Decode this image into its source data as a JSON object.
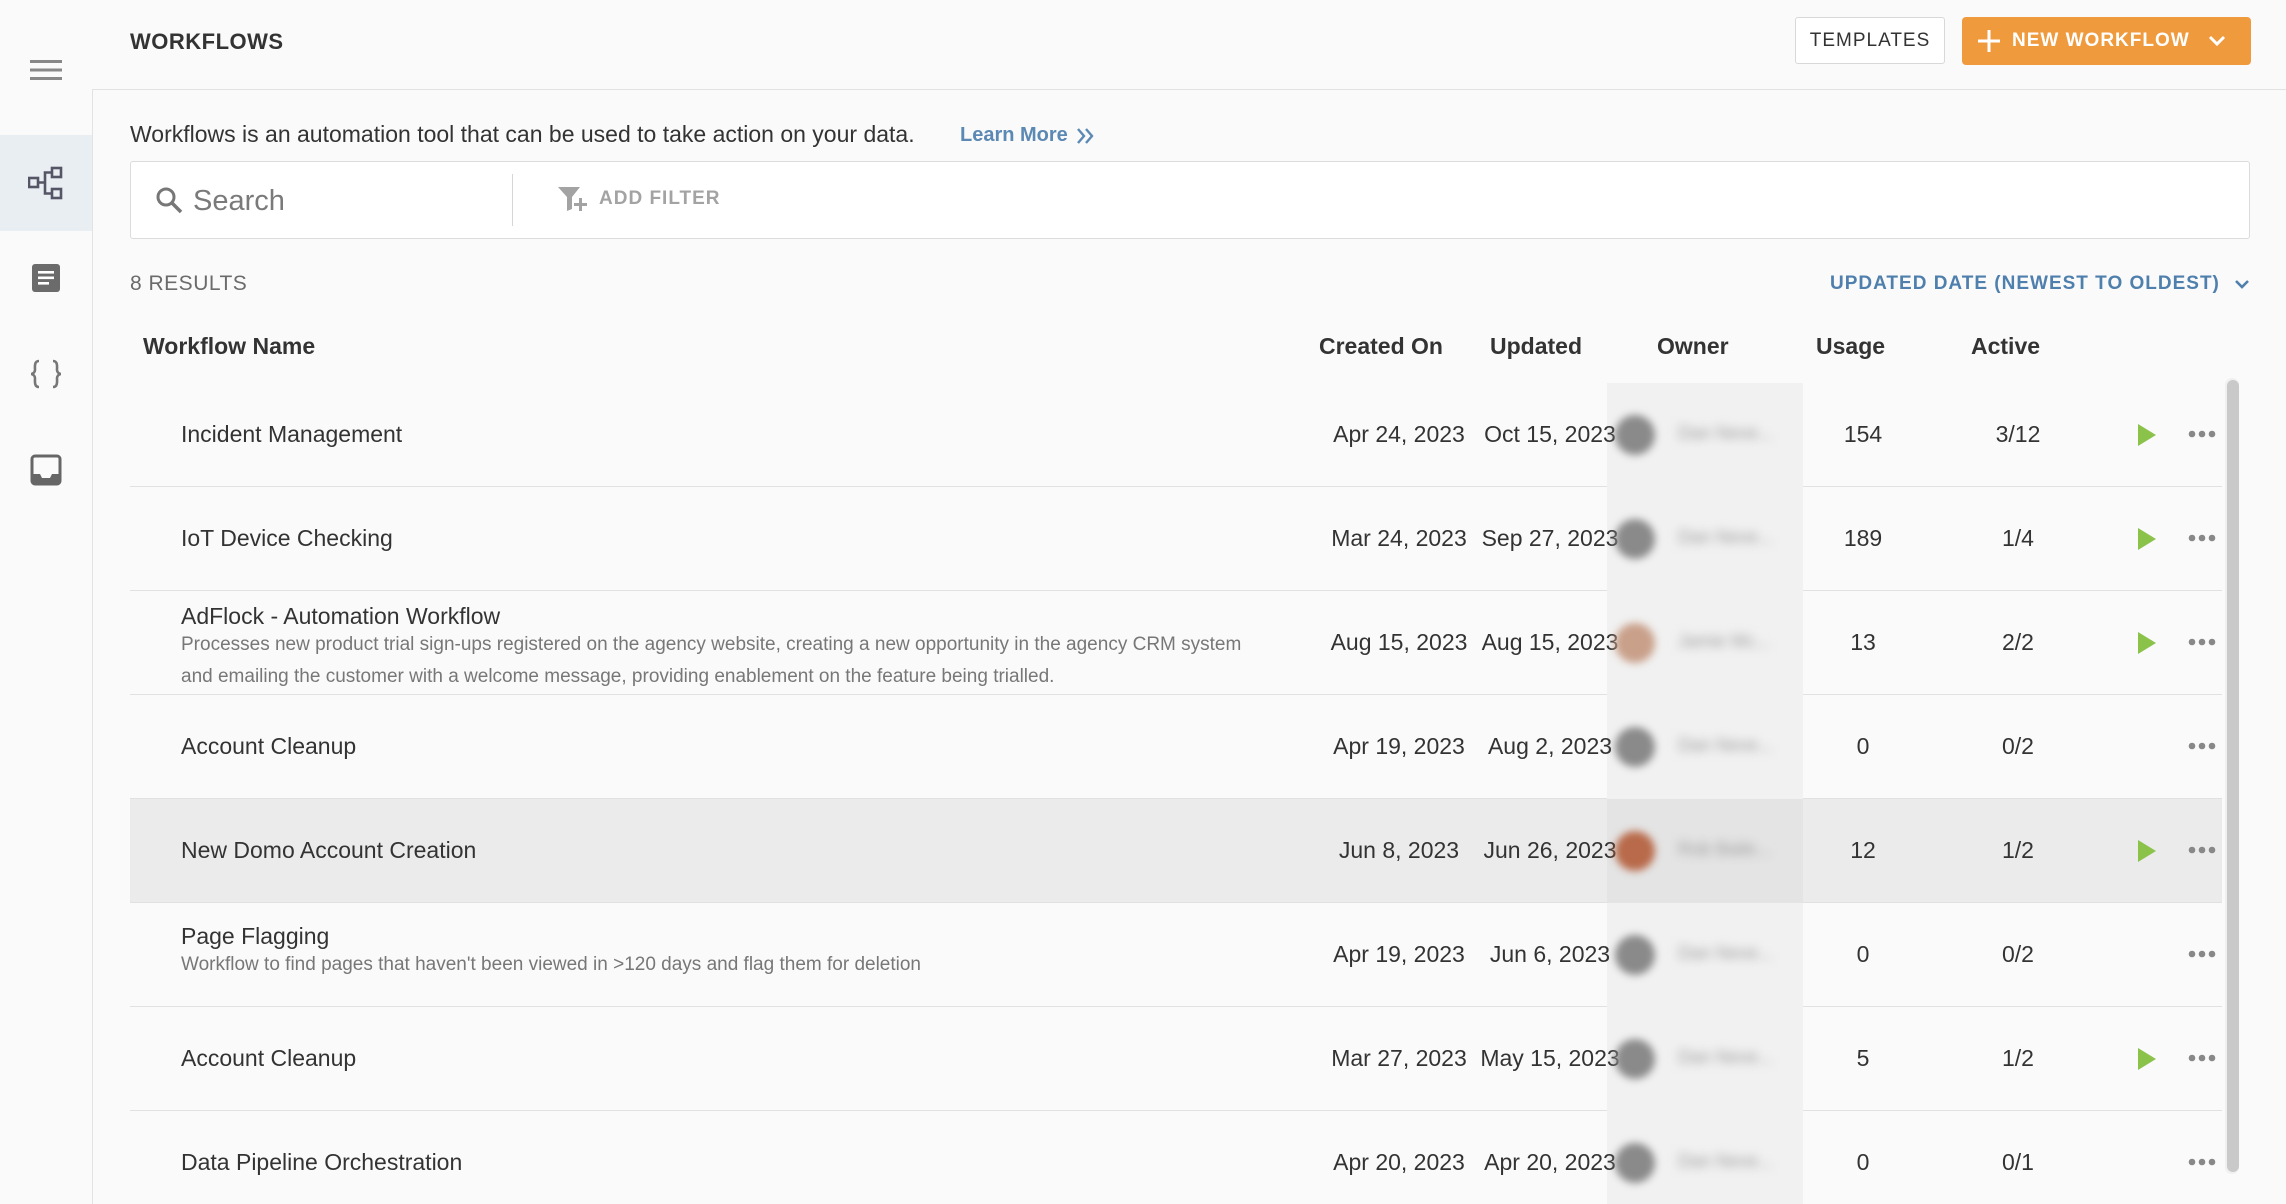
{
  "sidebar": {
    "items": [
      {
        "icon": "menu-icon"
      },
      {
        "icon": "workflow-icon",
        "active": true
      },
      {
        "icon": "document-icon"
      },
      {
        "icon": "code-braces-icon"
      },
      {
        "icon": "inbox-icon"
      }
    ]
  },
  "header": {
    "title": "WORKFLOWS",
    "templates_label": "TEMPLATES",
    "new_workflow_label": "NEW WORKFLOW"
  },
  "intro": {
    "text": "Workflows is an automation tool that can be used to take action on your data.",
    "learn_more": "Learn More"
  },
  "search": {
    "placeholder": "Search",
    "add_filter_label": "ADD FILTER"
  },
  "results": {
    "count_label": "8 RESULTS",
    "sort_label": "UPDATED DATE (NEWEST TO OLDEST)"
  },
  "table": {
    "columns": {
      "name": "Workflow Name",
      "created": "Created On",
      "updated": "Updated",
      "owner": "Owner",
      "usage": "Usage",
      "active": "Active"
    },
    "rows": [
      {
        "name": "Incident Management",
        "description": "",
        "created": "Apr 24, 2023",
        "updated": "Oct 15, 2023",
        "owner": "Dan Neve...",
        "usage": "154",
        "active": "3/12",
        "playable": true
      },
      {
        "name": "IoT Device Checking",
        "description": "",
        "created": "Mar 24, 2023",
        "updated": "Sep 27, 2023",
        "owner": "Dan Neve...",
        "usage": "189",
        "active": "1/4",
        "playable": true
      },
      {
        "name": "AdFlock - Automation Workflow",
        "description": "Processes new product trial sign-ups registered on the agency website, creating a new opportunity in the agency CRM system and emailing the customer with a welcome message, providing enablement on the feature being trialled.",
        "created": "Aug 15, 2023",
        "updated": "Aug 15, 2023",
        "owner": "Jamie Mc...",
        "usage": "13",
        "active": "2/2",
        "playable": true
      },
      {
        "name": "Account Cleanup",
        "description": "",
        "created": "Apr 19, 2023",
        "updated": "Aug 2, 2023",
        "owner": "Dan Neve...",
        "usage": "0",
        "active": "0/2",
        "playable": false
      },
      {
        "name": "New Domo Account Creation",
        "description": "",
        "created": "Jun 8, 2023",
        "updated": "Jun 26, 2023",
        "owner": "Rob Baile...",
        "usage": "12",
        "active": "1/2",
        "playable": true
      },
      {
        "name": "Page Flagging",
        "description": "Workflow to find pages that haven't been viewed in >120 days and flag them for deletion",
        "created": "Apr 19, 2023",
        "updated": "Jun 6, 2023",
        "owner": "Dan Neve...",
        "usage": "0",
        "active": "0/2",
        "playable": false
      },
      {
        "name": "Account Cleanup",
        "description": "",
        "created": "Mar 27, 2023",
        "updated": "May 15, 2023",
        "owner": "Dan Neve...",
        "usage": "5",
        "active": "1/2",
        "playable": true
      },
      {
        "name": "Data Pipeline Orchestration",
        "description": "",
        "created": "Apr 20, 2023",
        "updated": "Apr 20, 2023",
        "owner": "Dan Neve...",
        "usage": "0",
        "active": "0/1",
        "playable": false
      }
    ]
  },
  "colors": {
    "accent": "#f09a3e",
    "link": "#5b89b4",
    "play": "#8bc34a",
    "active_nav": "#e9eef3"
  }
}
